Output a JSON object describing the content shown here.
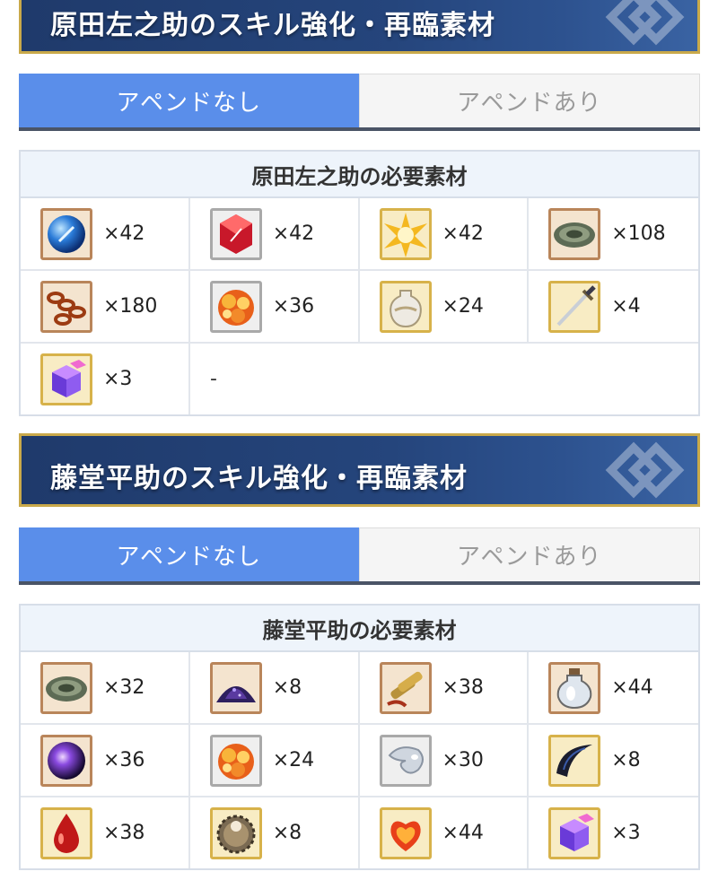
{
  "sections": [
    {
      "title": "原田左之助のスキル強化・再臨素材",
      "tabs": [
        "アペンドなし",
        "アペンドあり"
      ],
      "table_header": "原田左之助の必要素材",
      "items": [
        {
          "icon": "blue-orb-icon",
          "count": "×42"
        },
        {
          "icon": "red-gem-icon",
          "count": "×42"
        },
        {
          "icon": "gold-star-icon",
          "count": "×42"
        },
        {
          "icon": "bronze-disc-icon",
          "count": "×108"
        },
        {
          "icon": "chain-icon",
          "count": "×180"
        },
        {
          "icon": "orange-crystal-icon",
          "count": "×36"
        },
        {
          "icon": "white-vase-icon",
          "count": "×24"
        },
        {
          "icon": "sword-icon",
          "count": "×4"
        },
        {
          "icon": "purple-cube-icon",
          "count": "×3"
        }
      ],
      "filler": "-"
    },
    {
      "title": "藤堂平助のスキル強化・再臨素材",
      "tabs": [
        "アペンドなし",
        "アペンドあり"
      ],
      "table_header": "藤堂平助の必要素材",
      "items": [
        {
          "icon": "bronze-disc-icon",
          "count": "×32"
        },
        {
          "icon": "purple-sand-icon",
          "count": "×8"
        },
        {
          "icon": "shells-icon",
          "count": "×38"
        },
        {
          "icon": "glass-bottle-icon",
          "count": "×44"
        },
        {
          "icon": "dark-orb-icon",
          "count": "×36"
        },
        {
          "icon": "orange-crystal-icon",
          "count": "×24"
        },
        {
          "icon": "silver-droplet-icon",
          "count": "×30"
        },
        {
          "icon": "black-claw-icon",
          "count": "×8"
        },
        {
          "icon": "red-drop-icon",
          "count": "×38"
        },
        {
          "icon": "gear-sphere-icon",
          "count": "×8"
        },
        {
          "icon": "fire-heart-icon",
          "count": "×44"
        },
        {
          "icon": "purple-cube-icon",
          "count": "×3"
        }
      ]
    }
  ],
  "colors": {
    "banner": "#1f3a6b",
    "banner_border": "#c9a94a",
    "tab_active": "#5a8eea",
    "table_border": "#d7dee8"
  }
}
